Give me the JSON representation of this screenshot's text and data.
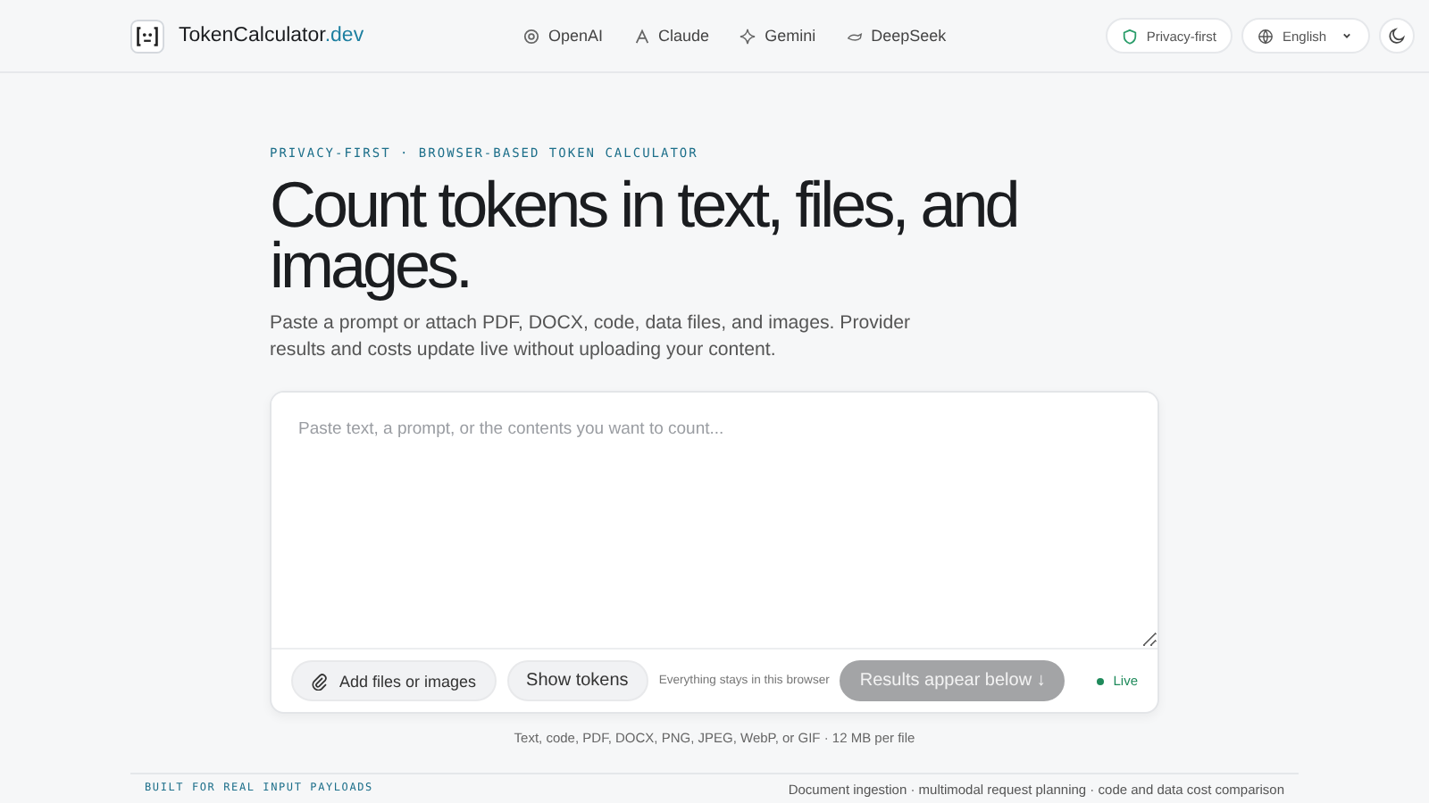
{
  "header": {
    "brand": "TokenCalculator",
    "brand_suffix": ".dev",
    "nav": [
      {
        "label": "OpenAI"
      },
      {
        "label": "Claude"
      },
      {
        "label": "Gemini"
      },
      {
        "label": "DeepSeek"
      }
    ],
    "privacy_badge": "Privacy-first",
    "language": "English"
  },
  "hero": {
    "eyebrow": "PRIVACY-FIRST · BROWSER-BASED TOKEN CALCULATOR",
    "title": "Count tokens in text, files, and images.",
    "description": "Paste a prompt or attach PDF, DOCX, code, data files, and images. Provider results and costs update live without uploading your content."
  },
  "input": {
    "placeholder": "Paste text, a prompt, or the contents you want to count...",
    "add_button": "Add files or images",
    "show_tokens_button": "Show tokens",
    "note": "Everything stays in this browser",
    "results_button": {
      "label": "Results appear below ↓",
      "disabled": true
    },
    "status": {
      "label": "Live",
      "color": "#1f8a5b"
    }
  },
  "formats_note": "Text, code, PDF, DOCX, PNG, JPEG, WebP, or GIF · 12 MB per file",
  "footer_band": {
    "eyebrow": "BUILT FOR REAL INPUT PAYLOADS",
    "text": "Document ingestion · multimodal request planning · code and data cost comparison"
  }
}
